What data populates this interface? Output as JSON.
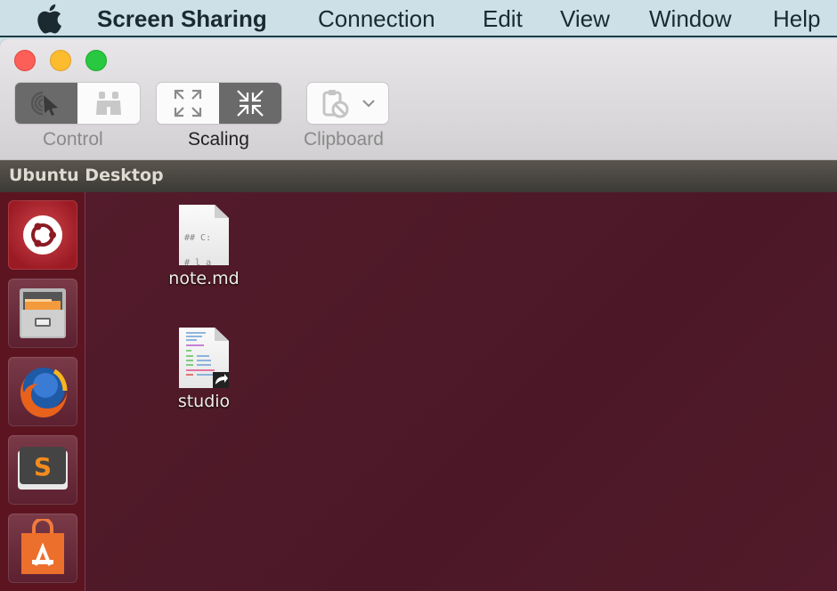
{
  "menubar": {
    "apple_icon": "apple-logo-icon",
    "app_name": "Screen Sharing",
    "items": [
      "Connection",
      "Edit",
      "View",
      "Window",
      "Help"
    ]
  },
  "window": {
    "traffic_lights": [
      "close",
      "minimize",
      "zoom"
    ],
    "toolbar": {
      "control": {
        "label": "Control",
        "options": [
          {
            "icon": "control-cursor-icon",
            "selected": true
          },
          {
            "icon": "binoculars-observe-icon",
            "selected": false
          }
        ]
      },
      "scaling": {
        "label": "Scaling",
        "options": [
          {
            "icon": "expand-arrows-icon",
            "selected": false
          },
          {
            "icon": "shrink-arrows-icon",
            "selected": true
          }
        ]
      },
      "clipboard": {
        "label": "Clipboard",
        "icon": "clipboard-disabled-icon",
        "dropdown_icon": "chevron-down-icon",
        "enabled": false
      }
    },
    "remote_title": "Ubuntu Desktop"
  },
  "launcher": {
    "items": [
      {
        "name": "Ubuntu Dash",
        "icon": "ubuntu-logo-icon"
      },
      {
        "name": "Files",
        "icon": "file-cabinet-icon"
      },
      {
        "name": "Firefox",
        "icon": "firefox-icon"
      },
      {
        "name": "Sublime Text",
        "icon": "sublime-text-icon"
      },
      {
        "name": "Ubuntu Software",
        "icon": "shopping-bag-icon"
      }
    ]
  },
  "desktop": {
    "icons": [
      {
        "label": "note.md",
        "icon": "markdown-file-icon",
        "preview": "## C:\n# l a"
      },
      {
        "label": "studio",
        "icon": "script-file-shortcut-icon"
      }
    ]
  },
  "colors": {
    "desktop_bg": "#4f1a28",
    "launcher_bg": "#5c1520",
    "segment_selected": "#6a6a6a",
    "menubar_bg": "#cde0e8"
  }
}
